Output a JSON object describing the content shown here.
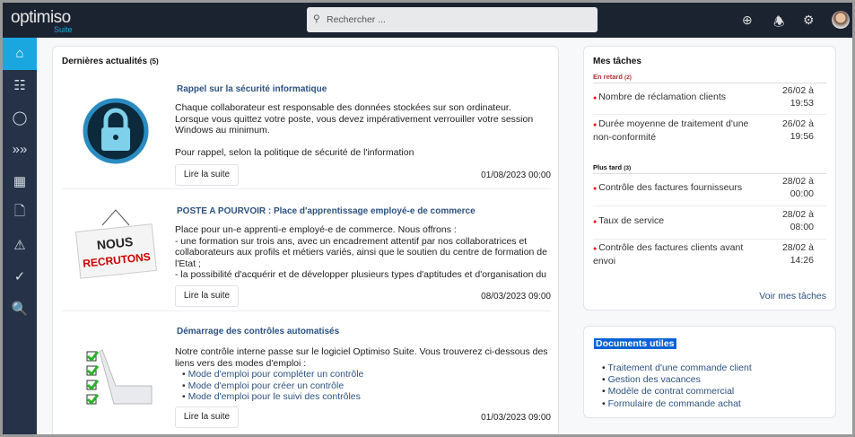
{
  "app": {
    "logo_main": "optimiso",
    "logo_sub": "Suite"
  },
  "search": {
    "placeholder": "Rechercher ..."
  },
  "sidebar": [
    "home-icon",
    "org-chart-icon",
    "user-icon",
    "process-icon",
    "workflow-icon",
    "document-icon",
    "warning-icon",
    "shield-check-icon",
    "report-search-icon"
  ],
  "news": {
    "title": "Dernières actualités",
    "count": "(5)",
    "read_more": "Lire la suite",
    "articles": [
      {
        "title": "Rappel sur la sécurité informatique",
        "lines": [
          "Chaque collaborateur est responsable des données stockées sur son ordinateur.",
          "Lorsque vous quittez votre poste, vous devez impérativement verrouiller votre session Windows au minimum.",
          "",
          "Pour rappel, selon la politique de sécurité de l'information"
        ],
        "date": "01/08/2023 00:00"
      },
      {
        "title": "POSTE A POURVOIR : Place d'apprentissage employé-e de commerce",
        "lines": [
          "Place pour un-e apprenti-e employé-e de commerce. Nous offrons :",
          "- une formation sur trois ans, avec un encadrement attentif par nos collaboratrices et collaborateurs aux profils et métiers variés, ainsi que le soutien du centre de formation de l'Etat ;",
          "- la possibilité d'acquérir et de développer plusieurs types d'aptitudes et d'organisation du travail auprès de nos différents services (administratif, rh, comptabilité) ;"
        ],
        "image_text": [
          "NOUS",
          "RECRUTONS"
        ],
        "date": "08/03/2023 09:00"
      },
      {
        "title": "Démarrage des contrôles automatisés",
        "lines": [
          "Notre contrôle interne passe sur le logiciel Optimiso Suite. Vous trouverez ci-dessous des liens vers des modes d'emploi :"
        ],
        "links": [
          "Mode d'emploi pour compléter un contrôle",
          "Mode d'emploi pour créer un contrôle",
          "Mode d'emploi pour le suivi des contrôles"
        ],
        "date": "01/03/2023 09:00"
      }
    ]
  },
  "tasks": {
    "title": "Mes tâches",
    "late_label": "En retard",
    "late_count": "(2)",
    "later_label": "Plus tard",
    "later_count": "(3)",
    "late": [
      {
        "name": "Nombre de réclamation clients",
        "d1": "26/02 à",
        "d2": "19:53"
      },
      {
        "name": "Durée moyenne de traitement d'une non-conformité",
        "d1": "26/02 à",
        "d2": "19:56"
      }
    ],
    "later": [
      {
        "name": "Contrôle des factures fournisseurs",
        "d1": "28/02 à",
        "d2": "00:00"
      },
      {
        "name": "Taux de service",
        "d1": "28/02 à",
        "d2": "08:00"
      },
      {
        "name": "Contrôle des factures clients avant envoi",
        "d1": "28/02 à",
        "d2": "14:26"
      }
    ],
    "see_all": "Voir mes tâches"
  },
  "docs": {
    "title": "Documents utiles",
    "items": [
      "Traitement d'une commande client",
      "Gestion des vacances",
      "Modèle de contrat commercial",
      "Formulaire de commande achat"
    ]
  }
}
